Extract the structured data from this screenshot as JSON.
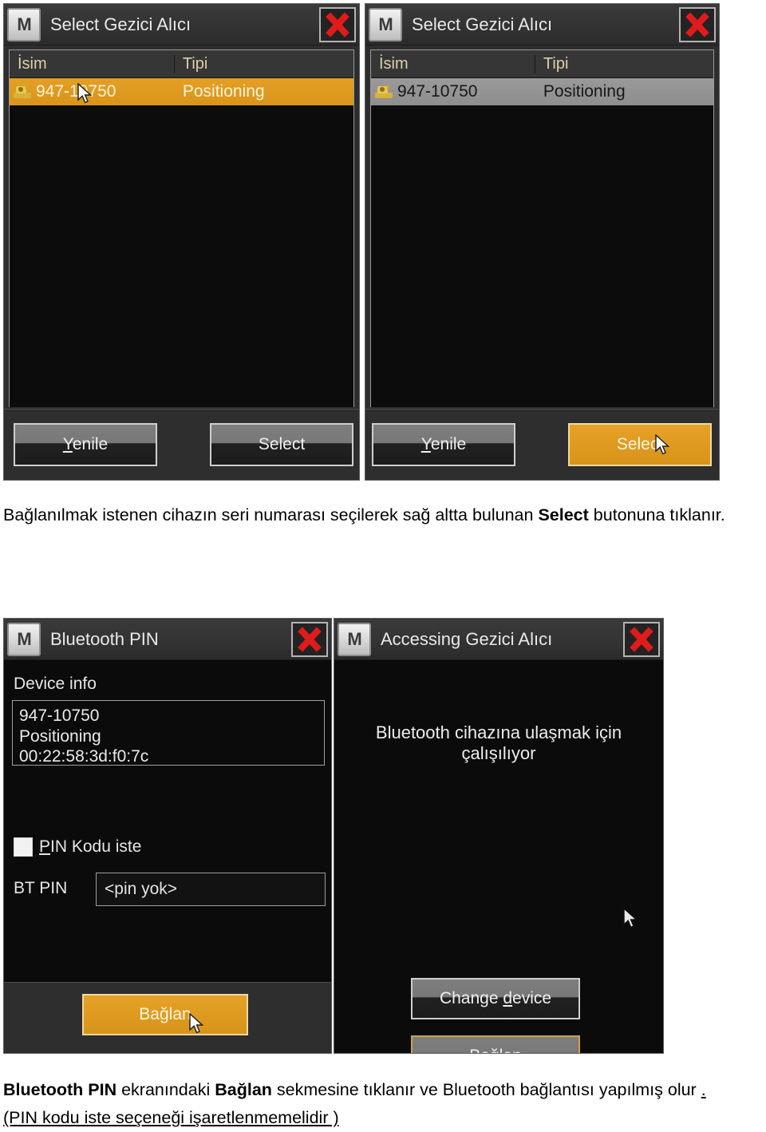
{
  "panels": {
    "select_left": {
      "title": "Select Gezici Alıcı",
      "logo": "M",
      "close_icon": "close-x-icon",
      "columns": [
        "İsim",
        "Tipi"
      ],
      "rows": [
        {
          "name": "947-10750",
          "type": "Positioning",
          "selected": true,
          "highlight": "orange"
        }
      ],
      "buttons": {
        "refresh": "Yenile",
        "select": "Select"
      }
    },
    "select_right": {
      "title": "Select Gezici Alıcı",
      "logo": "M",
      "close_icon": "close-x-icon",
      "columns": [
        "İsim",
        "Tipi"
      ],
      "rows": [
        {
          "name": "947-10750",
          "type": "Positioning",
          "selected": true,
          "highlight": "gray"
        }
      ],
      "buttons": {
        "refresh": "Yenile",
        "select": "Select"
      }
    },
    "bluetooth_pin": {
      "title": "Bluetooth PIN",
      "logo": "M",
      "close_icon": "close-x-icon",
      "device_info_label": "Device info",
      "device_info": [
        "947-10750",
        "Positioning",
        "00:22:58:3d:f0:7c"
      ],
      "pin_request_label": "PIN Kodu iste",
      "pin_request_checked": false,
      "bt_pin_label": "BT PIN",
      "bt_pin_value": "<pin yok>",
      "connect_button": "Bağlan"
    },
    "accessing": {
      "title": "Accessing Gezici Alıcı",
      "logo": "M",
      "close_icon": "close-x-icon",
      "status_text": "Bluetooth cihazına ulaşmak için çalışılıyor",
      "change_device_button": "Change device",
      "connect_button": "Bağlan"
    }
  },
  "captions": {
    "first": {
      "before": "Bağlanılmak istenen cihazın seri numarası seçilerek sağ altta bulunan ",
      "bold": "Select",
      "after": " butonuna tıklanır."
    },
    "second": {
      "bold1": "Bluetooth PIN",
      "mid1": " ekranındaki ",
      "bold2": "Bağlan",
      "mid2": " sekmesine tıklanır ve Bluetooth bağlantısı yapılmış olur ",
      "tail": ".",
      "underlined_line": "(PIN kodu iste seçeneği işaretlenmemelidir )"
    }
  },
  "colors": {
    "accent_orange": "#d8941a",
    "window_bg": "#2e2e2e",
    "list_bg": "#0c0c0c",
    "header_text": "#ddd0a8",
    "close_red": "#e01b1b"
  }
}
